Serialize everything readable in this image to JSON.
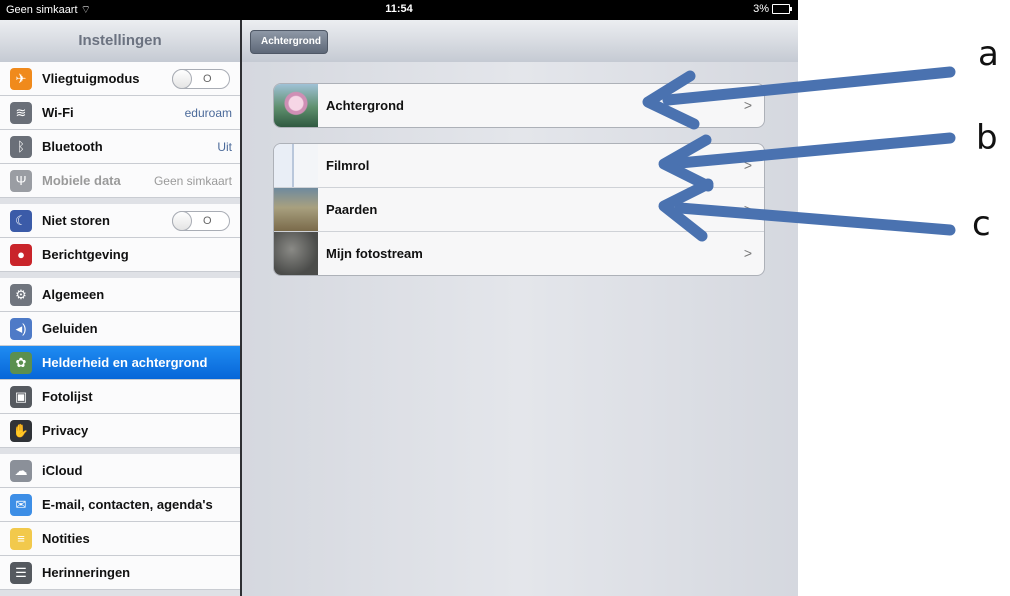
{
  "status_bar": {
    "carrier": "Geen simkaart",
    "time": "11:54",
    "battery": "3%"
  },
  "sidebar": {
    "title": "Instellingen",
    "items": [
      {
        "label": "Vliegtuigmodus",
        "icon": "airplane-icon",
        "color": "#f08a1c",
        "toggle": true
      },
      {
        "label": "Wi-Fi",
        "icon": "wifi-icon",
        "color": "#6a6f78",
        "value": "eduroam"
      },
      {
        "label": "Bluetooth",
        "icon": "bluetooth-icon",
        "color": "#6a6f78",
        "value": "Uit"
      },
      {
        "label": "Mobiele data",
        "icon": "antenna-icon",
        "color": "#9a9da3",
        "value": "Geen simkaart",
        "disabled": true
      },
      {
        "label": "Niet storen",
        "icon": "moon-icon",
        "color": "#3b5ba8",
        "toggle": true
      },
      {
        "label": "Berichtgeving",
        "icon": "notification-icon",
        "color": "#c9242a"
      },
      {
        "label": "Algemeen",
        "icon": "gear-icon",
        "color": "#70757e"
      },
      {
        "label": "Geluiden",
        "icon": "speaker-icon",
        "color": "#4e7ac7"
      },
      {
        "label": "Helderheid en achtergrond",
        "icon": "flower-icon",
        "color": "#5b8f4f",
        "selected": true
      },
      {
        "label": "Fotolijst",
        "icon": "photo-frame-icon",
        "color": "#55595f"
      },
      {
        "label": "Privacy",
        "icon": "hand-icon",
        "color": "#2f3237"
      },
      {
        "label": "iCloud",
        "icon": "cloud-icon",
        "color": "#8b9099"
      },
      {
        "label": "E-mail, contacten, agenda's",
        "icon": "mail-icon",
        "color": "#3d8ee6"
      },
      {
        "label": "Notities",
        "icon": "notes-icon",
        "color": "#f2c94c"
      },
      {
        "label": "Herinneringen",
        "icon": "reminders-icon",
        "color": "#55595f"
      }
    ]
  },
  "navbar": {
    "back_label": "Achtergrond"
  },
  "content": {
    "group1": [
      {
        "label": "Achtergrond",
        "thumb": "lotus-thumbnail"
      }
    ],
    "group2": [
      {
        "label": "Filmrol",
        "thumb": "screenshot-thumbnail"
      },
      {
        "label": "Paarden",
        "thumb": "horses-thumbnail"
      },
      {
        "label": "Mijn fotostream",
        "thumb": "photostream-thumbnail"
      }
    ],
    "chevron": ">"
  },
  "annotations": {
    "a": "a",
    "b": "b",
    "c": "c",
    "arrow_color": "#4a72b0"
  }
}
